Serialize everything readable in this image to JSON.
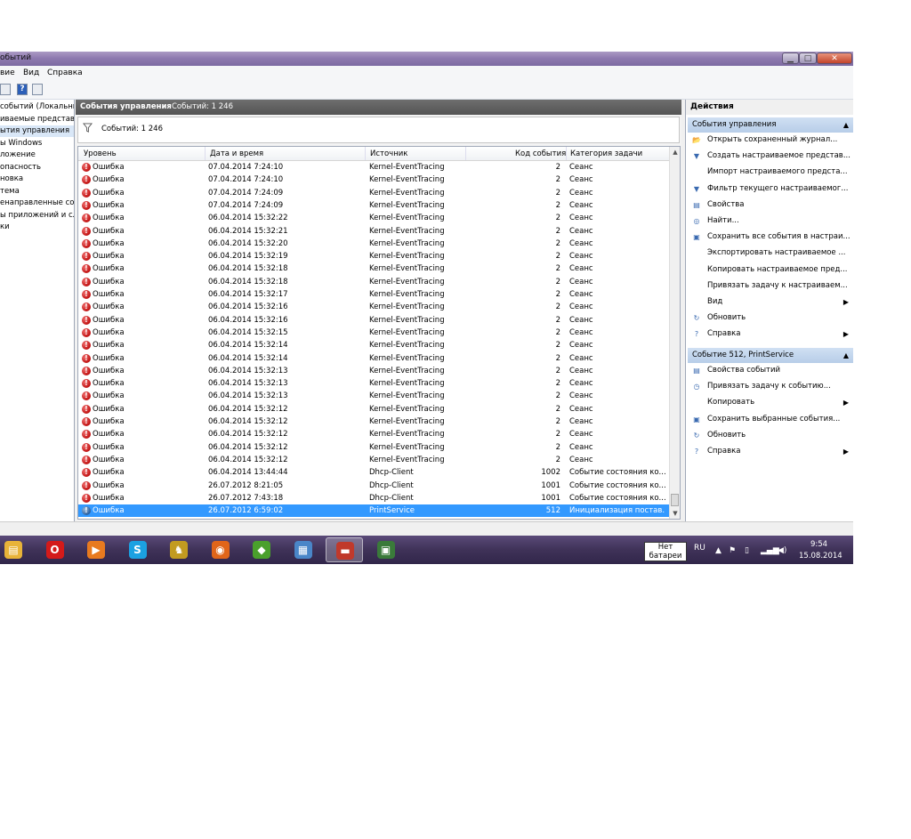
{
  "window": {
    "title": "обытий",
    "buttons": {
      "minimize": "▁",
      "maximize": "□",
      "close": "✕"
    }
  },
  "menu": [
    "вие",
    "Вид",
    "Справка"
  ],
  "toolbar": {
    "help_icon": "?"
  },
  "tree": [
    {
      "label": "событий (Локальнь"
    },
    {
      "label": "иваемые представле"
    },
    {
      "label": "ытия управления",
      "selected": true
    },
    {
      "label": "ы Windows"
    },
    {
      "label": "ложение"
    },
    {
      "label": "опасность"
    },
    {
      "label": "новка"
    },
    {
      "label": "тема"
    },
    {
      "label": "енаправленные соб"
    },
    {
      "label": "ы приложений и сл"
    },
    {
      "label": "ки"
    }
  ],
  "center": {
    "header_title": "События управления",
    "header_count": "Событий: 1 246",
    "filter_count": "Событий: 1 246",
    "columns": [
      "Уровень",
      "Дата и время",
      "Источник",
      "Код события",
      "Категория задачи"
    ],
    "rows": [
      {
        "level": "Ошибка",
        "date": "07.04.2014 7:24:10",
        "source": "Kernel-EventTracing",
        "code": "2",
        "category": "Сеанс"
      },
      {
        "level": "Ошибка",
        "date": "07.04.2014 7:24:10",
        "source": "Kernel-EventTracing",
        "code": "2",
        "category": "Сеанс"
      },
      {
        "level": "Ошибка",
        "date": "07.04.2014 7:24:09",
        "source": "Kernel-EventTracing",
        "code": "2",
        "category": "Сеанс"
      },
      {
        "level": "Ошибка",
        "date": "07.04.2014 7:24:09",
        "source": "Kernel-EventTracing",
        "code": "2",
        "category": "Сеанс"
      },
      {
        "level": "Ошибка",
        "date": "06.04.2014 15:32:22",
        "source": "Kernel-EventTracing",
        "code": "2",
        "category": "Сеанс"
      },
      {
        "level": "Ошибка",
        "date": "06.04.2014 15:32:21",
        "source": "Kernel-EventTracing",
        "code": "2",
        "category": "Сеанс"
      },
      {
        "level": "Ошибка",
        "date": "06.04.2014 15:32:20",
        "source": "Kernel-EventTracing",
        "code": "2",
        "category": "Сеанс"
      },
      {
        "level": "Ошибка",
        "date": "06.04.2014 15:32:19",
        "source": "Kernel-EventTracing",
        "code": "2",
        "category": "Сеанс"
      },
      {
        "level": "Ошибка",
        "date": "06.04.2014 15:32:18",
        "source": "Kernel-EventTracing",
        "code": "2",
        "category": "Сеанс"
      },
      {
        "level": "Ошибка",
        "date": "06.04.2014 15:32:18",
        "source": "Kernel-EventTracing",
        "code": "2",
        "category": "Сеанс"
      },
      {
        "level": "Ошибка",
        "date": "06.04.2014 15:32:17",
        "source": "Kernel-EventTracing",
        "code": "2",
        "category": "Сеанс"
      },
      {
        "level": "Ошибка",
        "date": "06.04.2014 15:32:16",
        "source": "Kernel-EventTracing",
        "code": "2",
        "category": "Сеанс"
      },
      {
        "level": "Ошибка",
        "date": "06.04.2014 15:32:16",
        "source": "Kernel-EventTracing",
        "code": "2",
        "category": "Сеанс"
      },
      {
        "level": "Ошибка",
        "date": "06.04.2014 15:32:15",
        "source": "Kernel-EventTracing",
        "code": "2",
        "category": "Сеанс"
      },
      {
        "level": "Ошибка",
        "date": "06.04.2014 15:32:14",
        "source": "Kernel-EventTracing",
        "code": "2",
        "category": "Сеанс"
      },
      {
        "level": "Ошибка",
        "date": "06.04.2014 15:32:14",
        "source": "Kernel-EventTracing",
        "code": "2",
        "category": "Сеанс"
      },
      {
        "level": "Ошибка",
        "date": "06.04.2014 15:32:13",
        "source": "Kernel-EventTracing",
        "code": "2",
        "category": "Сеанс"
      },
      {
        "level": "Ошибка",
        "date": "06.04.2014 15:32:13",
        "source": "Kernel-EventTracing",
        "code": "2",
        "category": "Сеанс"
      },
      {
        "level": "Ошибка",
        "date": "06.04.2014 15:32:13",
        "source": "Kernel-EventTracing",
        "code": "2",
        "category": "Сеанс"
      },
      {
        "level": "Ошибка",
        "date": "06.04.2014 15:32:12",
        "source": "Kernel-EventTracing",
        "code": "2",
        "category": "Сеанс"
      },
      {
        "level": "Ошибка",
        "date": "06.04.2014 15:32:12",
        "source": "Kernel-EventTracing",
        "code": "2",
        "category": "Сеанс"
      },
      {
        "level": "Ошибка",
        "date": "06.04.2014 15:32:12",
        "source": "Kernel-EventTracing",
        "code": "2",
        "category": "Сеанс"
      },
      {
        "level": "Ошибка",
        "date": "06.04.2014 15:32:12",
        "source": "Kernel-EventTracing",
        "code": "2",
        "category": "Сеанс"
      },
      {
        "level": "Ошибка",
        "date": "06.04.2014 15:32:12",
        "source": "Kernel-EventTracing",
        "code": "2",
        "category": "Сеанс"
      },
      {
        "level": "Ошибка",
        "date": "06.04.2014 13:44:44",
        "source": "Dhcp-Client",
        "code": "1002",
        "category": "Событие состояния ко..."
      },
      {
        "level": "Ошибка",
        "date": "26.07.2012 8:21:05",
        "source": "Dhcp-Client",
        "code": "1001",
        "category": "Событие состояния ко..."
      },
      {
        "level": "Ошибка",
        "date": "26.07.2012 7:43:18",
        "source": "Dhcp-Client",
        "code": "1001",
        "category": "Событие состояния ко..."
      },
      {
        "level": "Ошибка",
        "date": "26.07.2012 6:59:02",
        "source": "PrintService",
        "code": "512",
        "category": "Инициализация постав...",
        "selected": true
      }
    ]
  },
  "actions": {
    "title": "Действия",
    "section1": {
      "title": "События управления",
      "items": [
        {
          "label": "Открыть сохраненный журнал...",
          "icon": "folder-open-icon",
          "glyph": "📂"
        },
        {
          "label": "Создать настраиваемое представ...",
          "icon": "filter-create-icon",
          "glyph": "▼"
        },
        {
          "label": "Импорт настраиваемого предста...",
          "icon": "",
          "glyph": ""
        },
        {
          "label": "Фильтр текущего настраиваемог...",
          "icon": "filter-icon",
          "glyph": "▼"
        },
        {
          "label": "Свойства",
          "icon": "properties-icon",
          "glyph": "▤"
        },
        {
          "label": "Найти...",
          "icon": "binoculars-icon",
          "glyph": "◎"
        },
        {
          "label": "Сохранить все события в настраи...",
          "icon": "save-icon",
          "glyph": "▣"
        },
        {
          "label": "Экспортировать настраиваемое ...",
          "icon": "",
          "glyph": ""
        },
        {
          "label": "Копировать настраиваемое пред...",
          "icon": "",
          "glyph": ""
        },
        {
          "label": "Привязать задачу к настраиваем...",
          "icon": "",
          "glyph": ""
        },
        {
          "label": "Вид",
          "icon": "",
          "glyph": "",
          "submenu": "▶"
        },
        {
          "label": "Обновить",
          "icon": "refresh-icon",
          "glyph": "↻"
        },
        {
          "label": "Справка",
          "icon": "help-icon",
          "glyph": "?",
          "submenu": "▶"
        }
      ]
    },
    "section2": {
      "title": "Событие 512, PrintService",
      "items": [
        {
          "label": "Свойства событий",
          "icon": "event-properties-icon",
          "glyph": "▤"
        },
        {
          "label": "Привязать задачу к событию...",
          "icon": "task-icon",
          "glyph": "◷"
        },
        {
          "label": "Копировать",
          "icon": "",
          "glyph": "",
          "submenu": "▶"
        },
        {
          "label": "Сохранить выбранные события...",
          "icon": "save-icon",
          "glyph": "▣"
        },
        {
          "label": "Обновить",
          "icon": "refresh-icon",
          "glyph": "↻"
        },
        {
          "label": "Справка",
          "icon": "help-icon",
          "glyph": "?",
          "submenu": "▶"
        }
      ]
    },
    "collapse_glyph": "▲"
  },
  "taskbar": {
    "apps": [
      {
        "name": "explorer-icon",
        "glyph": "▤",
        "color": "#e8b339"
      },
      {
        "name": "opera-icon",
        "glyph": "O",
        "color": "#d41a1a"
      },
      {
        "name": "media-player-icon",
        "glyph": "▶",
        "color": "#e87a1f"
      },
      {
        "name": "skype-icon",
        "glyph": "S",
        "color": "#1ba1e2"
      },
      {
        "name": "game-icon",
        "glyph": "♞",
        "color": "#c29b20"
      },
      {
        "name": "firefox-icon",
        "glyph": "◉",
        "color": "#e0651a"
      },
      {
        "name": "app-cube-icon",
        "glyph": "◆",
        "color": "#4aa02c"
      },
      {
        "name": "remote-desktop-icon",
        "glyph": "▦",
        "color": "#4a86c8"
      },
      {
        "name": "toolbox-icon",
        "glyph": "▬",
        "color": "#c0392b",
        "active": true
      },
      {
        "name": "event-viewer-icon",
        "glyph": "▣",
        "color": "#3a7a3a"
      }
    ],
    "battery_tip": "Нет батареи",
    "lang": "RU",
    "time": "9:54",
    "date": "15.08.2014"
  },
  "colors": {
    "selection": "#3399ff",
    "error": "#c01010",
    "actions_header": "#c6d7ee"
  }
}
